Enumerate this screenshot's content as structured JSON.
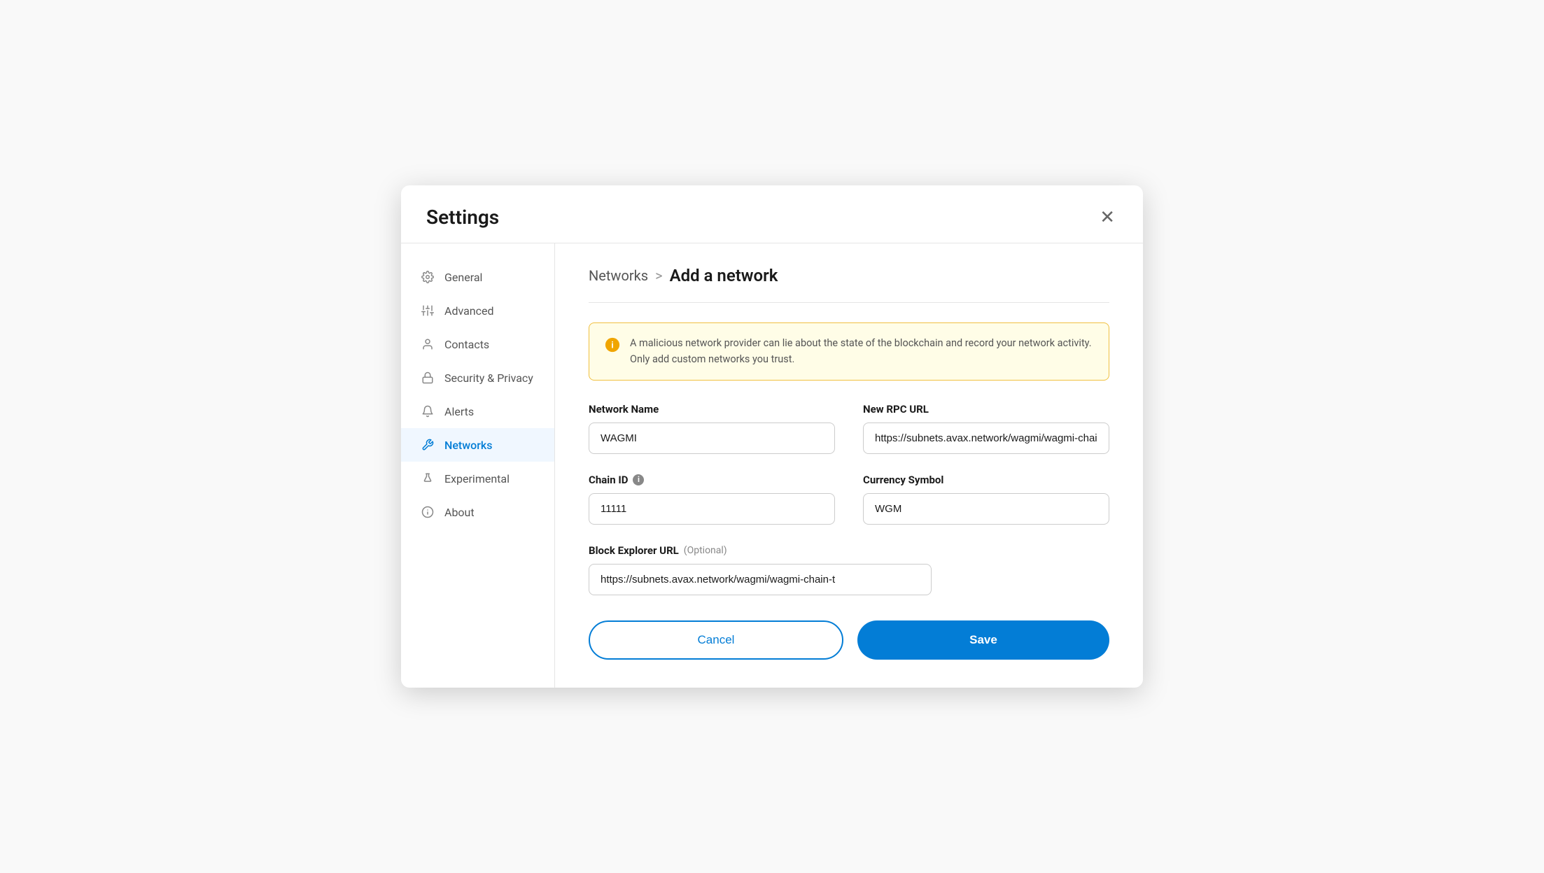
{
  "modal": {
    "title": "Settings",
    "close_label": "✕"
  },
  "sidebar": {
    "items": [
      {
        "id": "general",
        "label": "General",
        "icon": "gear"
      },
      {
        "id": "advanced",
        "label": "Advanced",
        "icon": "sliders"
      },
      {
        "id": "contacts",
        "label": "Contacts",
        "icon": "person"
      },
      {
        "id": "security",
        "label": "Security & Privacy",
        "icon": "lock"
      },
      {
        "id": "alerts",
        "label": "Alerts",
        "icon": "bell"
      },
      {
        "id": "networks",
        "label": "Networks",
        "icon": "wrench",
        "active": true
      },
      {
        "id": "experimental",
        "label": "Experimental",
        "icon": "flask"
      },
      {
        "id": "about",
        "label": "About",
        "icon": "info"
      }
    ]
  },
  "main": {
    "breadcrumb_parent": "Networks",
    "breadcrumb_separator": ">",
    "breadcrumb_current": "Add a network",
    "warning_text": "A malicious network provider can lie about the state of the blockchain and record your network activity. Only add custom networks you trust.",
    "fields": {
      "network_name_label": "Network Name",
      "network_name_value": "WAGMI",
      "network_name_placeholder": "Network Name",
      "rpc_url_label": "New RPC URL",
      "rpc_url_value": "https://subnets.avax.network/wagmi/wagmi-chain-t",
      "rpc_url_placeholder": "New RPC URL",
      "chain_id_label": "Chain ID",
      "chain_id_value": "11111",
      "chain_id_placeholder": "Chain ID",
      "currency_symbol_label": "Currency Symbol",
      "currency_symbol_value": "WGM",
      "currency_symbol_placeholder": "Currency Symbol",
      "block_explorer_label": "Block Explorer URL",
      "block_explorer_optional": "(Optional)",
      "block_explorer_value": "https://subnets.avax.network/wagmi/wagmi-chain-t",
      "block_explorer_placeholder": "Block Explorer URL"
    },
    "buttons": {
      "cancel": "Cancel",
      "save": "Save"
    }
  }
}
